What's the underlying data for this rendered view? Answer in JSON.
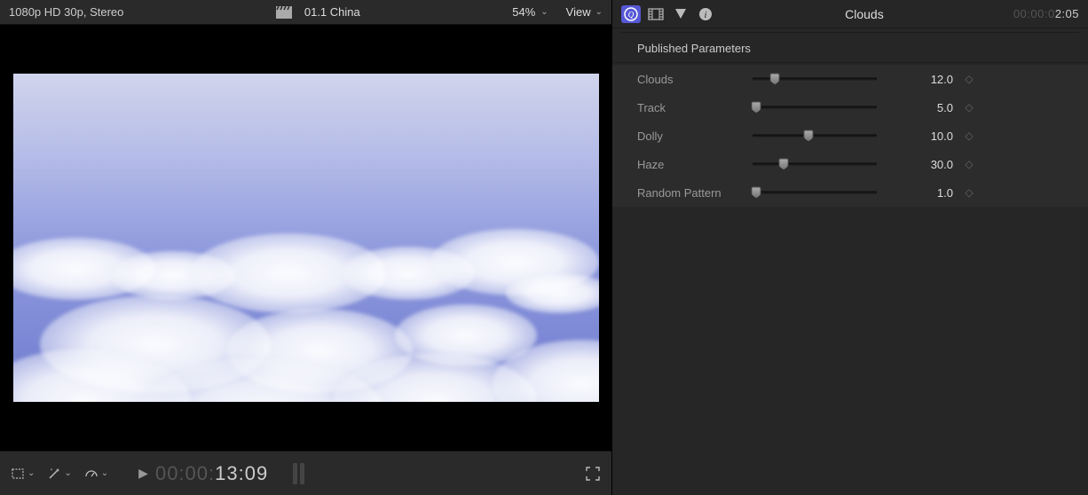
{
  "viewer": {
    "format": "1080p HD 30p, Stereo",
    "clip_name": "01.1 China",
    "zoom": "54%",
    "view_label": "View",
    "timecode_prefix": "00:00:",
    "timecode_main": "13:09"
  },
  "inspector": {
    "tabs": [
      "generator",
      "video",
      "color",
      "info"
    ],
    "title": "Clouds",
    "timecode_prefix": "00:00:0",
    "timecode_main": "2:05",
    "section_title": "Published Parameters",
    "params": [
      {
        "label": "Clouds",
        "value": "12.0",
        "pos": 18
      },
      {
        "label": "Track",
        "value": "5.0",
        "pos": 3
      },
      {
        "label": "Dolly",
        "value": "10.0",
        "pos": 45
      },
      {
        "label": "Haze",
        "value": "30.0",
        "pos": 25
      },
      {
        "label": "Random Pattern",
        "value": "1.0",
        "pos": 3
      }
    ]
  }
}
